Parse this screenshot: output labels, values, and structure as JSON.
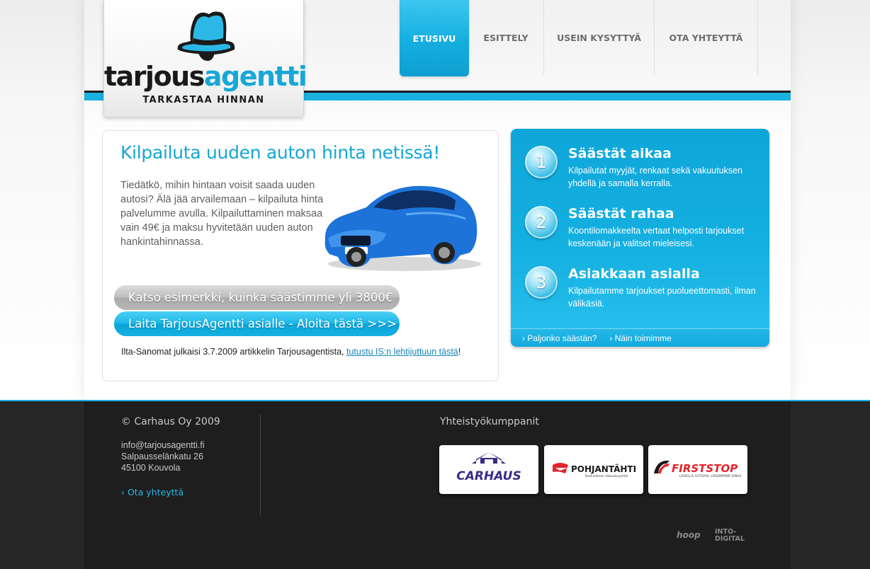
{
  "logo": {
    "word_dark": "tarjous",
    "word_blue": "agentti",
    "tagline": "TARKASTAA HINNAN"
  },
  "nav": {
    "items": [
      {
        "label": "ETUSIVU"
      },
      {
        "label": "ESITTELY"
      },
      {
        "label": "USEIN KYSYTTYÄ"
      },
      {
        "label": "OTA YHTEYTTÄ"
      }
    ]
  },
  "main": {
    "headline": "Kilpailuta uuden auton hinta netissä!",
    "intro": "Tiedätkö, mihin hintaan voisit saada uuden autosi? Älä jää arvailemaan – kilpailuta hinta palvelumme avulla. Kilpailuttaminen maksaa vain 49€ ja maksu hyvitetään uuden auton hankintahinnassa.",
    "example_button": "Katso esimerkki, kuinka säästimme yli 3800€",
    "start_button": "Laita TarjousAgentti asialle - Aloita tästä >>>",
    "news_text": "Ilta-Sanomat julkaisi 3.7.2009 artikkelin Tarjousagentista, ",
    "news_link": "tutustu IS:n lehtijuttuun tästä",
    "news_end": "!"
  },
  "steps": [
    {
      "num": "1",
      "title": "Säästät aikaa",
      "text": "Kilpailutat myyjät, renkaat sekä vakuutuksen yhdellä ja samalla kerralla."
    },
    {
      "num": "2",
      "title": "Säästät rahaa",
      "text": "Koontilomakkeelta vertaat helposti tarjoukset keskenään ja valitset mieleisesi."
    },
    {
      "num": "3",
      "title": "Asiakkaan asialla",
      "text": "Kilpailutamme tarjoukset puolueettomasti, ilman välikäsiä."
    }
  ],
  "panel_links": {
    "link1": "› Paljonko säästän?",
    "link2": "› Näin toimimme"
  },
  "footer": {
    "copyright": "© Carhaus Oy 2009",
    "email": "info@tarjousagentti.fi",
    "street": "Salpausselänkatu 26",
    "city": "45100 Kouvola",
    "contact_link": "› Ota yhteyttä",
    "partners_title": "Yhteistyökumppanit",
    "partners": [
      {
        "name": "CARHAUS"
      },
      {
        "name": "POHJANTÄHTI",
        "sub": "Keskinäinen Vakuutusyhtiö"
      },
      {
        "name": "FIRSTSTOP",
        "sub": "LÄHELLÄ AUTOASI, LÄHEMPÄNÄ SINUA."
      }
    ],
    "credit1": "hoop",
    "credit2_line1": "INTO-",
    "credit2_line2": "DIGITAL"
  },
  "colors": {
    "accent": "#1ab0df",
    "footer_bg": "#1e1e1e",
    "headline": "#15a6d6"
  }
}
